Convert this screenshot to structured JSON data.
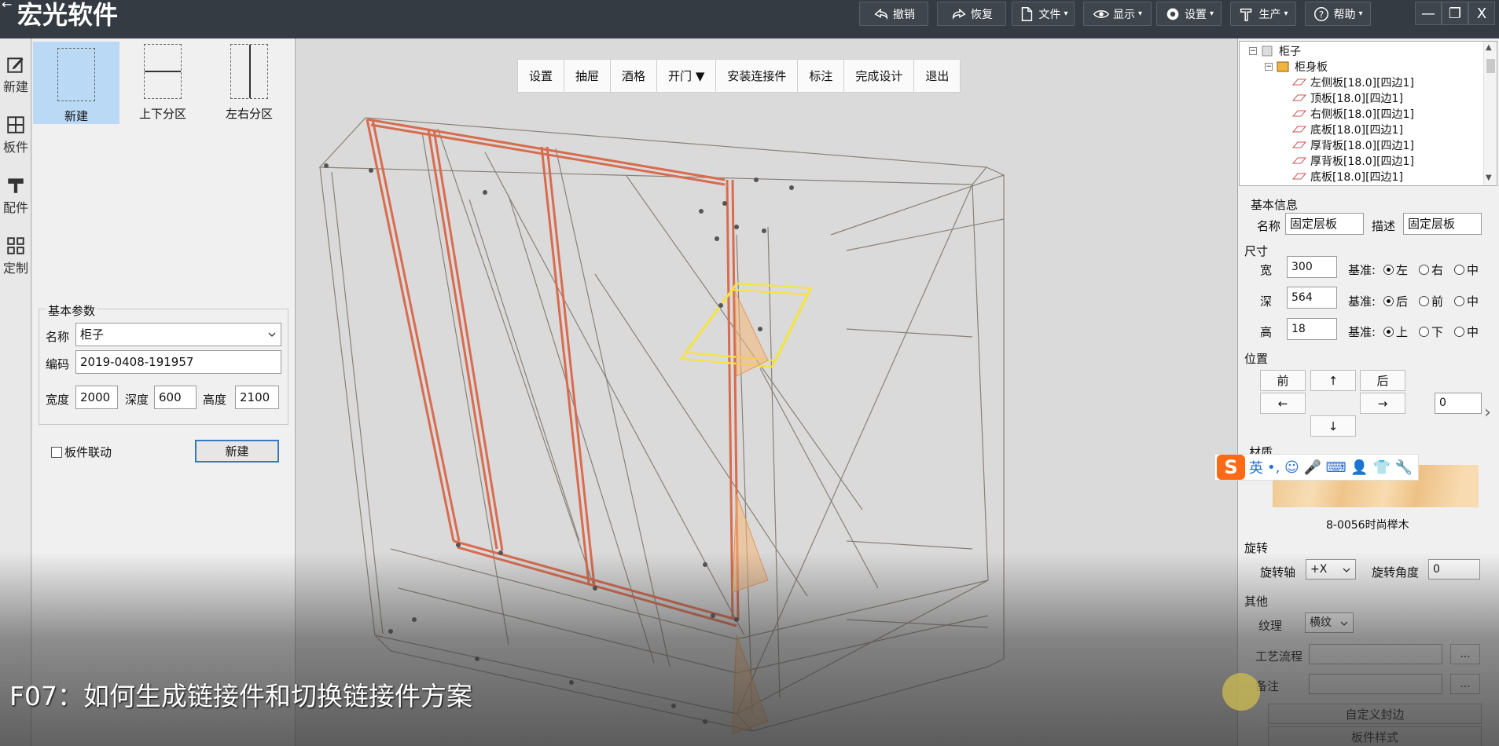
{
  "window": {
    "title": "宏光软件",
    "toolbar": [
      {
        "label": "撤销",
        "icon": "undo-icon",
        "has_caret": false
      },
      {
        "label": "恢复",
        "icon": "redo-icon",
        "has_caret": false
      },
      {
        "label": "文件",
        "icon": "file-icon",
        "has_caret": true
      },
      {
        "label": "显示",
        "icon": "eye-icon",
        "has_caret": true
      },
      {
        "label": "设置",
        "icon": "gear-icon",
        "has_caret": true
      },
      {
        "label": "生产",
        "icon": "hammer-icon",
        "has_caret": true
      },
      {
        "label": "帮助",
        "icon": "help-icon",
        "has_caret": true
      }
    ],
    "controls": [
      "minimize",
      "restore",
      "close"
    ]
  },
  "rail": [
    {
      "label": "新建",
      "icon": "edit-icon"
    },
    {
      "label": "板件",
      "icon": "panel-icon"
    },
    {
      "label": "配件",
      "icon": "hardware-icon"
    },
    {
      "label": "定制",
      "icon": "grid-icon"
    }
  ],
  "templates": [
    {
      "label": "新建",
      "active": true
    },
    {
      "label": "上下分区",
      "active": false
    },
    {
      "label": "左右分区",
      "active": false
    }
  ],
  "basic_params": {
    "legend": "基本参数",
    "name_label": "名称",
    "name_value": "柜子",
    "code_label": "编码",
    "code_value": "2019-0408-191957",
    "width_label": "宽度",
    "width_value": "2000",
    "depth_label": "深度",
    "depth_value": "600",
    "height_label": "高度",
    "height_value": "2100",
    "link_label": "板件联动",
    "new_button": "新建"
  },
  "viewport_toolbar": [
    "设置",
    "抽屉",
    "酒格",
    "开门 ▼",
    "安装连接件",
    "标注",
    "完成设计",
    "退出"
  ],
  "caption": "F07：如何生成链接件和切换链接件方案",
  "tree": {
    "root": "柜子",
    "group": "柜身板",
    "items": [
      "左侧板[18.0][四边1]",
      "顶板[18.0][四边1]",
      "右侧板[18.0][四边1]",
      "底板[18.0][四边1]",
      "厚背板[18.0][四边1]",
      "厚背板[18.0][四边1]",
      "底板[18.0][四边1]"
    ]
  },
  "props": {
    "basic_info": "基本信息",
    "name_label": "名称",
    "name_value": "固定层板",
    "desc_label": "描述",
    "desc_value": "固定层板",
    "size_title": "尺寸",
    "width_label": "宽",
    "width_value": "300",
    "depth_label": "深",
    "depth_value": "564",
    "height_label": "高",
    "height_value": "18",
    "base_label": "基准:",
    "width_radios": [
      {
        "label": "左",
        "on": true
      },
      {
        "label": "右",
        "on": false
      },
      {
        "label": "中",
        "on": false
      }
    ],
    "depth_radios": [
      {
        "label": "后",
        "on": true
      },
      {
        "label": "前",
        "on": false
      },
      {
        "label": "中",
        "on": false
      }
    ],
    "height_radios": [
      {
        "label": "上",
        "on": true
      },
      {
        "label": "下",
        "on": false
      },
      {
        "label": "中",
        "on": false
      }
    ],
    "position_title": "位置",
    "pos_front": "前",
    "pos_up": "↑",
    "pos_back": "后",
    "pos_left": "←",
    "pos_right": "→",
    "pos_down": "↓",
    "pos_value": "0",
    "material_title": "材质",
    "material_name": "8-0056时尚榉木",
    "rotate_title": "旋转",
    "axis_label": "旋转轴",
    "axis_value": "+X",
    "angle_label": "旋转角度",
    "angle_value": "0",
    "other_title": "其他",
    "grain_label": "纹理",
    "grain_value": "横纹",
    "process_label": "工艺流程",
    "notes_label": "备注",
    "ellipsis": "...",
    "custom_edge_button": "自定义封边",
    "panel_style_button": "板件样式"
  },
  "ime": {
    "logo": "S",
    "lang": "英",
    "icons": "•, ☺ 🎤 ⌨ 👤 👕 🔧"
  }
}
